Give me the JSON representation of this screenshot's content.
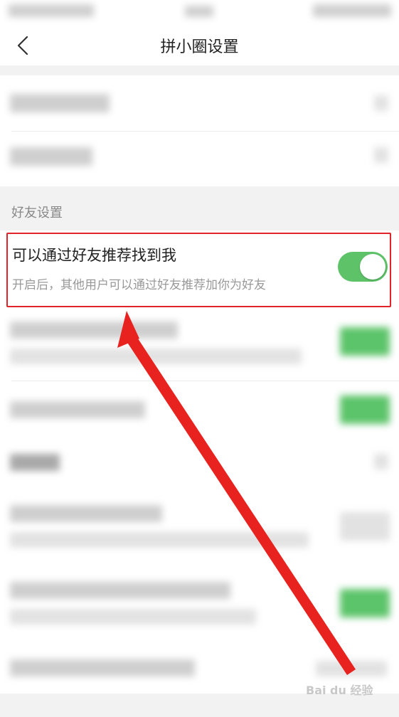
{
  "header": {
    "title": "拼小圈设置",
    "back_icon": "chevron-left-icon"
  },
  "friend_settings": {
    "section_label": "好友设置",
    "recommend_setting": {
      "title": "可以通过好友推荐找到我",
      "description": "开启后，其他用户可以通过好友推荐加你为好友",
      "enabled": true
    }
  },
  "colors": {
    "toggle_on": "#5ec368",
    "annotation_red": "#e0242a",
    "page_gap": "#f2f2f2"
  }
}
